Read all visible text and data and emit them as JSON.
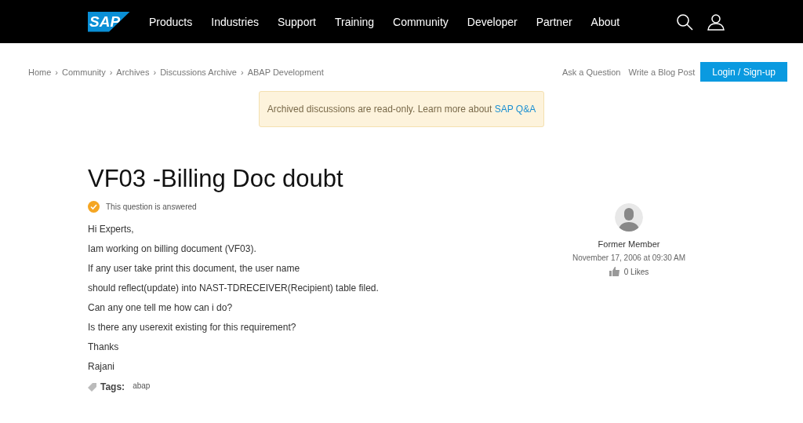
{
  "nav": {
    "logo": "SAP",
    "items": [
      "Products",
      "Industries",
      "Support",
      "Training",
      "Community",
      "Developer",
      "Partner",
      "About"
    ]
  },
  "breadcrumb": [
    "Home",
    "Community",
    "Archives",
    "Discussions Archive",
    "ABAP Development"
  ],
  "breadcrumb_separator": "›",
  "actions": {
    "links": [
      "Ask a Question",
      "Write a Blog Post"
    ],
    "login": "Login / Sign-up"
  },
  "notice": {
    "text": "Archived discussions are read-only. Learn more about ",
    "link": "SAP Q&A"
  },
  "question": {
    "title": "VF03 -Billing Doc doubt",
    "answered": true,
    "status": "This question is answered",
    "body": [
      "Hi Experts,",
      "Iam working on billing document (VF03).",
      "If any user take print this document, the user name",
      "should reflect(update) into NAST-TDRECEIVER(Recipient) table filed.",
      "Can any one tell me how can i do?",
      "Is there any userexit existing for this requirement?",
      "Thanks",
      "Rajani"
    ],
    "tags_label": "Tags:",
    "tags": [
      "abap"
    ]
  },
  "author": {
    "name": "Former Member",
    "date": "November 17, 2006 at 09:30 AM",
    "likes": "0 Likes"
  }
}
